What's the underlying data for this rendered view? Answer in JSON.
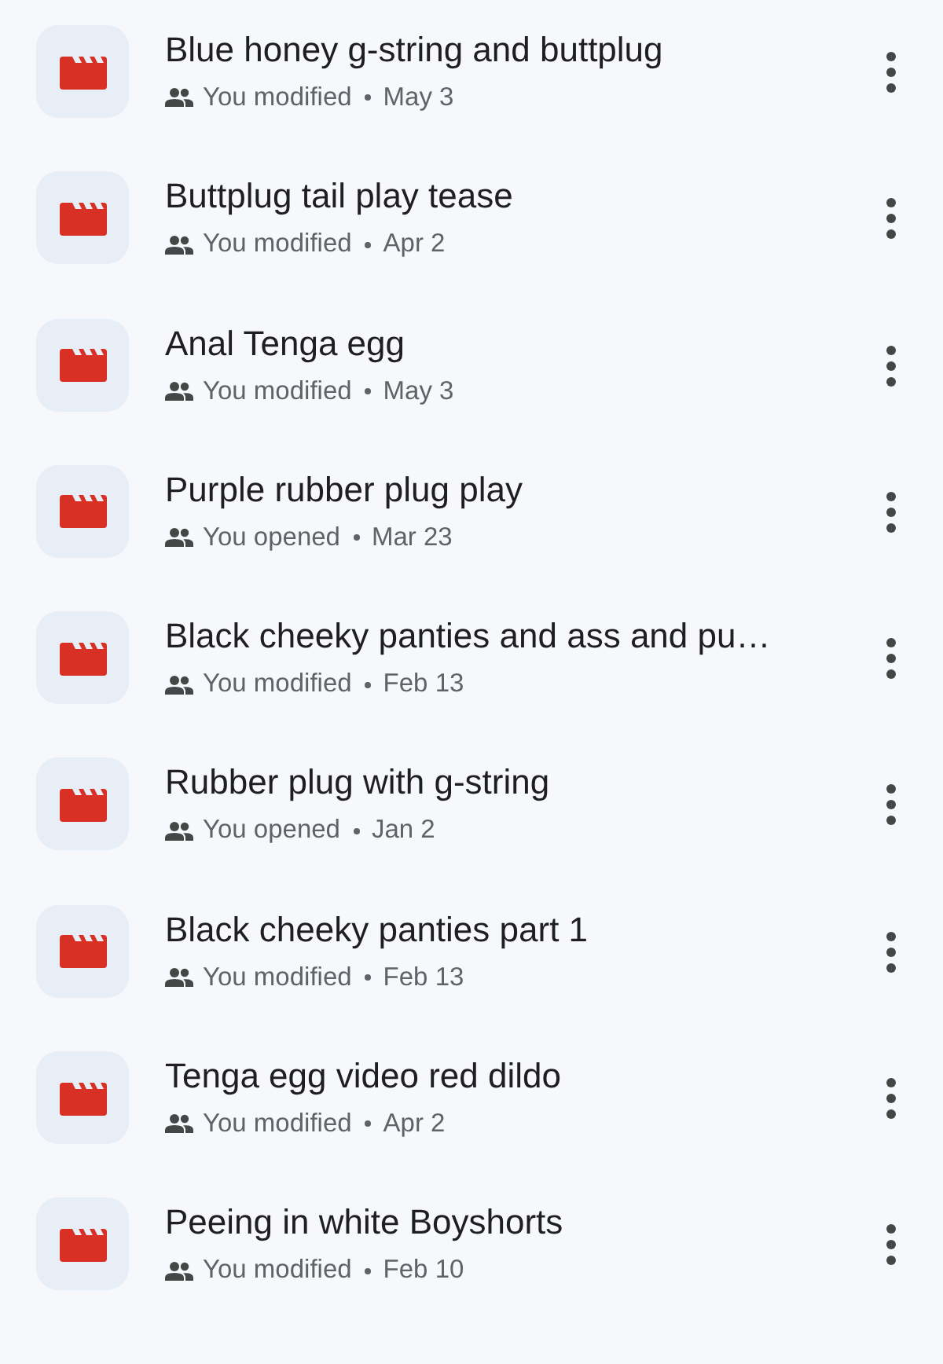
{
  "files": [
    {
      "title": "Blue honey g-string and buttplug",
      "activity": "You modified",
      "date": "May 3"
    },
    {
      "title": "Buttplug tail play tease",
      "activity": "You modified",
      "date": "Apr 2"
    },
    {
      "title": "Anal Tenga egg",
      "activity": "You modified",
      "date": "May 3"
    },
    {
      "title": "Purple rubber plug play",
      "activity": "You opened",
      "date": "Mar 23"
    },
    {
      "title": "Black cheeky panties and ass and pu…",
      "activity": "You modified",
      "date": "Feb 13"
    },
    {
      "title": "Rubber plug with g-string",
      "activity": "You opened",
      "date": "Jan 2"
    },
    {
      "title": "Black cheeky panties part 1",
      "activity": "You modified",
      "date": "Feb 13"
    },
    {
      "title": "Tenga egg video red dildo",
      "activity": "You modified",
      "date": "Apr 2"
    },
    {
      "title": "Peeing in white Boyshorts",
      "activity": "You modified",
      "date": "Feb 10"
    }
  ]
}
